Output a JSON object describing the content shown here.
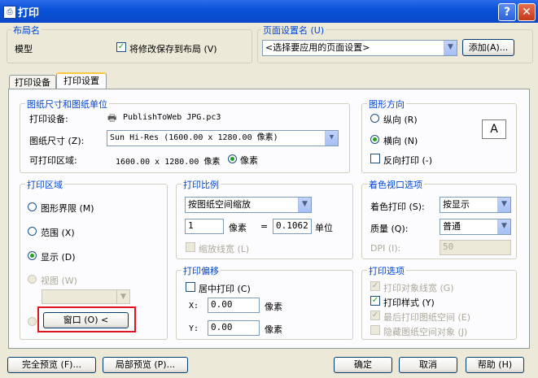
{
  "window": {
    "title": "打印",
    "help": "?",
    "close": "✕"
  },
  "layout_group": {
    "label": "布局名",
    "name": "模型",
    "save_label": "将修改保存到布局 (V)",
    "save_checked": true
  },
  "page_setup": {
    "label": "页面设置名 (U)",
    "value": "<选择要应用的页面设置>",
    "add_label": "添加(A)..."
  },
  "tabs": [
    {
      "label": "打印设备"
    },
    {
      "label": "打印设置"
    }
  ],
  "paper": {
    "group_label": "图纸尺寸和图纸单位",
    "device_label": "打印设备:",
    "device_value": "PublishToWeb JPG.pc3",
    "size_label": "图纸尺寸 (Z):",
    "size_value": "Sun Hi-Res (1600.00 x 1280.00 像素)",
    "area_label": "可打印区域:",
    "area_value": "1600.00 x 1280.00 像素",
    "unit_label": "像素"
  },
  "orientation": {
    "group_label": "图形方向",
    "portrait": "纵向 (R)",
    "landscape": "横向 (N)",
    "reverse": "反向打印 (-)",
    "selected": "landscape",
    "preview_letter": "A"
  },
  "print_area": {
    "group_label": "打印区域",
    "limits": "图形界限 (M)",
    "extents": "范围 (X)",
    "display": "显示 (D)",
    "view": "视图 (W)",
    "selected": "display",
    "window_button": "窗口 (O) <"
  },
  "scale": {
    "group_label": "打印比例",
    "mode": "按图纸空间缩放",
    "left_value": "1",
    "left_unit": "像素",
    "equals": "=",
    "right_value": "0.1062",
    "right_unit": "单位",
    "lineweight": "缩放线宽 (L)"
  },
  "offset": {
    "group_label": "打印偏移",
    "center": "居中打印 (C)",
    "x_label": "X:",
    "x_value": "0.00",
    "x_unit": "像素",
    "y_label": "Y:",
    "y_value": "0.00",
    "y_unit": "像素"
  },
  "shade": {
    "group_label": "着色视口选项",
    "shade_label": "着色打印 (S):",
    "shade_value": "按显示",
    "quality_label": "质量 (Q):",
    "quality_value": "普通",
    "dpi_label": "DPI (I):",
    "dpi_value": "50"
  },
  "options": {
    "group_label": "打印选项",
    "lineweights": "打印对象线宽 (G)",
    "styles": "打印样式 (Y)",
    "paperspace_last": "最后打印图纸空间 (E)",
    "hide": "隐藏图纸空间对象 (J)"
  },
  "footer": {
    "full_preview": "完全预览 (F)...",
    "partial_preview": "局部预览 (P)...",
    "ok": "确定",
    "cancel": "取消",
    "help": "帮助 (H)"
  },
  "colors": {
    "title_blue": "#0A53D8",
    "group_label": "#0046D5",
    "highlight_red": "#E0141E",
    "window_bg": "#ECE9D8"
  }
}
